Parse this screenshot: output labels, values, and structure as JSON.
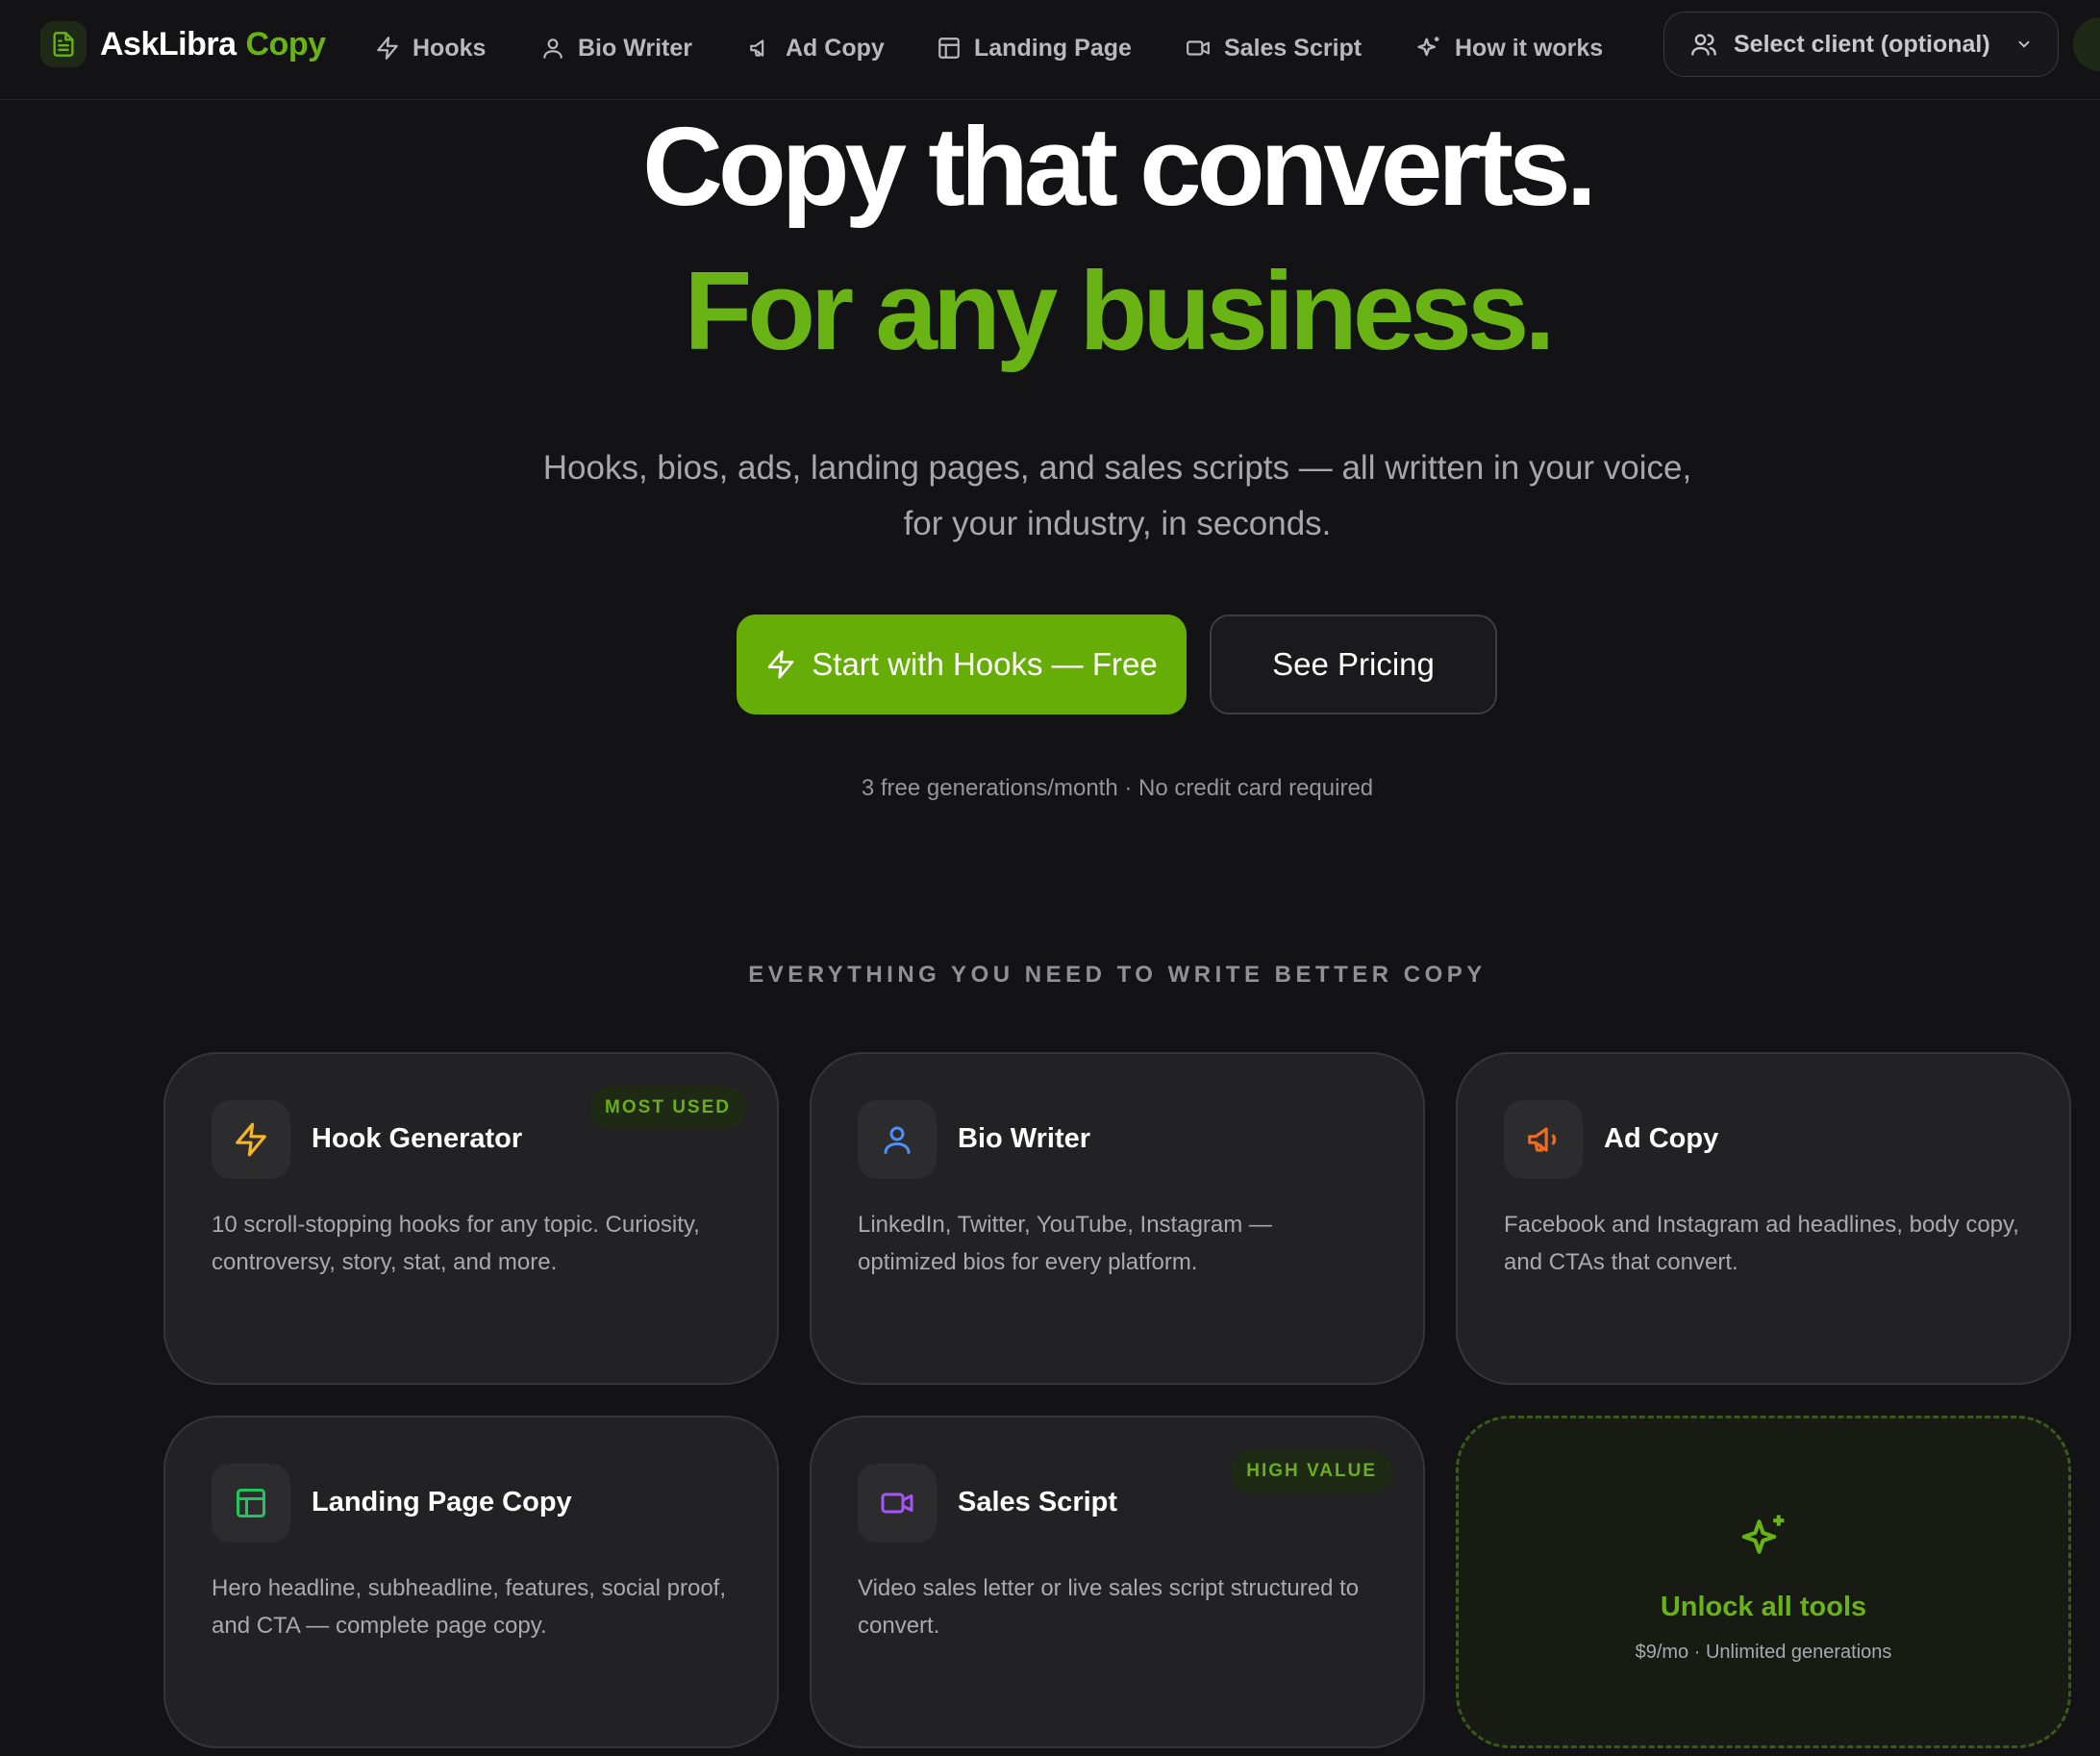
{
  "brand": {
    "name": "AskLibra",
    "accent": "Copy",
    "accent_color": "#69b315",
    "logo_icon": "document-icon"
  },
  "nav": {
    "items": [
      {
        "label": "Hooks",
        "icon": "lightning-icon"
      },
      {
        "label": "Bio Writer",
        "icon": "user-icon"
      },
      {
        "label": "Ad Copy",
        "icon": "megaphone-icon"
      },
      {
        "label": "Landing Page",
        "icon": "layout-icon"
      },
      {
        "label": "Sales Script",
        "icon": "video-icon"
      },
      {
        "label": "How it works",
        "icon": "sparkles-icon"
      }
    ],
    "client_select": {
      "label": "Select client (optional)",
      "icon": "users-icon"
    }
  },
  "hero": {
    "line1": "Copy that converts.",
    "line2": "For any business.",
    "subtitle": "Hooks, bios, ads, landing pages, and sales scripts — all written in your voice, for your industry, in seconds.",
    "primary_cta": "Start with Hooks — Free",
    "secondary_cta": "See Pricing",
    "note": "3 free generations/month · No credit card required"
  },
  "features": {
    "section_title": "EVERYTHING YOU NEED TO WRITE BETTER COPY",
    "cards": [
      {
        "title": "Hook Generator",
        "icon": "lightning-icon",
        "icon_color": "#f5b524",
        "badge": "MOST USED",
        "description": "10 scroll-stopping hooks for any topic. Curiosity, controversy, story, stat, and more."
      },
      {
        "title": "Bio Writer",
        "icon": "user-icon",
        "icon_color": "#4f8ff7",
        "description": "LinkedIn, Twitter, YouTube, Instagram — optimized bios for every platform."
      },
      {
        "title": "Ad Copy",
        "icon": "megaphone-icon",
        "icon_color": "#f26b1d",
        "description": "Facebook and Instagram ad headlines, body copy, and CTAs that convert."
      },
      {
        "title": "Landing Page Copy",
        "icon": "layout-icon",
        "icon_color": "#22c55e",
        "description": "Hero headline, subheadline, features, social proof, and CTA — complete page copy."
      },
      {
        "title": "Sales Script",
        "icon": "video-icon",
        "icon_color": "#a855f7",
        "badge": "HIGH VALUE",
        "description": "Video sales letter or live sales script structured to convert."
      }
    ],
    "unlock": {
      "title": "Unlock all tools",
      "subtitle": "$9/mo · Unlimited generations",
      "icon": "sparkles-icon"
    }
  }
}
